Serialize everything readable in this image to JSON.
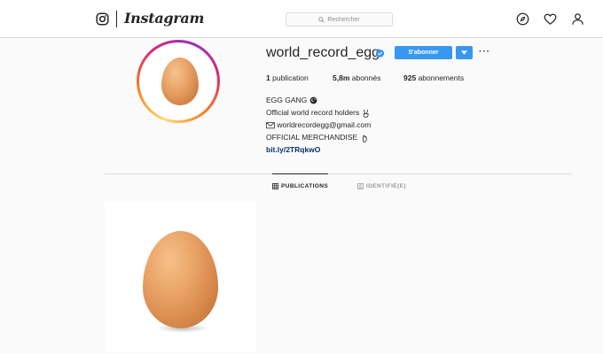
{
  "nav": {
    "brand": "Instagram",
    "search_placeholder": "Rechercher",
    "icons": [
      "camera-icon",
      "search-icon",
      "compass-icon",
      "heart-icon",
      "person-icon"
    ]
  },
  "profile": {
    "username": "world_record_egg",
    "verified": true,
    "follow_label": "S'abonner",
    "stats": {
      "posts_count": "1",
      "posts_label": "publication",
      "followers_count": "5,8m",
      "followers_label": "abonnés",
      "following_count": "925",
      "following_label": "abonnements"
    },
    "bio": {
      "name": "EGG GANG",
      "line1": "Official world record holders",
      "line2": "worldrecordegg@gmail.com",
      "line3": "OFFICIAL MERCHANDISE",
      "link": "bit.ly/2TRqkwO"
    }
  },
  "tabs": [
    {
      "label": "PUBLICATIONS",
      "active": true
    },
    {
      "label": "IDENTIFIÉ(E)",
      "active": false
    }
  ],
  "colors": {
    "accent": "#3897f0",
    "link": "#003569",
    "border": "#dbdbdb",
    "background": "#fafafa"
  }
}
